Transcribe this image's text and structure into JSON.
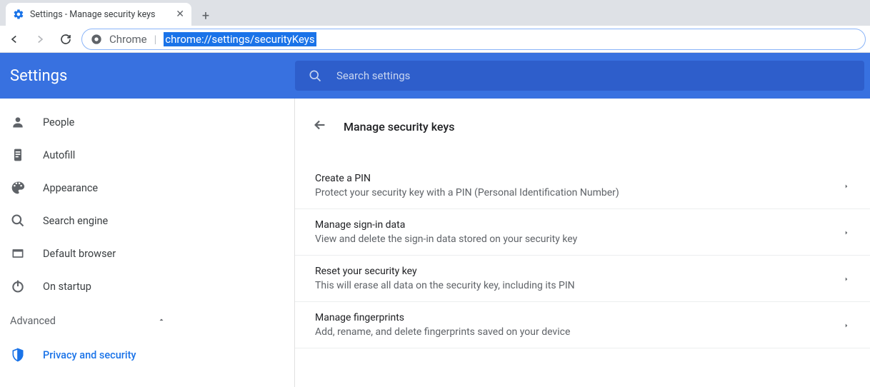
{
  "browser": {
    "tab_title": "Settings - Manage security keys",
    "omnibox_label": "Chrome",
    "url": "chrome://settings/securityKeys"
  },
  "header": {
    "title": "Settings",
    "search_placeholder": "Search settings"
  },
  "sidebar": {
    "items": [
      {
        "label": "People"
      },
      {
        "label": "Autofill"
      },
      {
        "label": "Appearance"
      },
      {
        "label": "Search engine"
      },
      {
        "label": "Default browser"
      },
      {
        "label": "On startup"
      }
    ],
    "advanced_label": "Advanced",
    "active_sub": "Privacy and security"
  },
  "main": {
    "page_title": "Manage security keys",
    "options": [
      {
        "title": "Create a PIN",
        "desc": "Protect your security key with a PIN (Personal Identification Number)"
      },
      {
        "title": "Manage sign-in data",
        "desc": "View and delete the sign-in data stored on your security key"
      },
      {
        "title": "Reset your security key",
        "desc": "This will erase all data on the security key, including its PIN"
      },
      {
        "title": "Manage fingerprints",
        "desc": "Add, rename, and delete fingerprints saved on your device"
      }
    ]
  }
}
